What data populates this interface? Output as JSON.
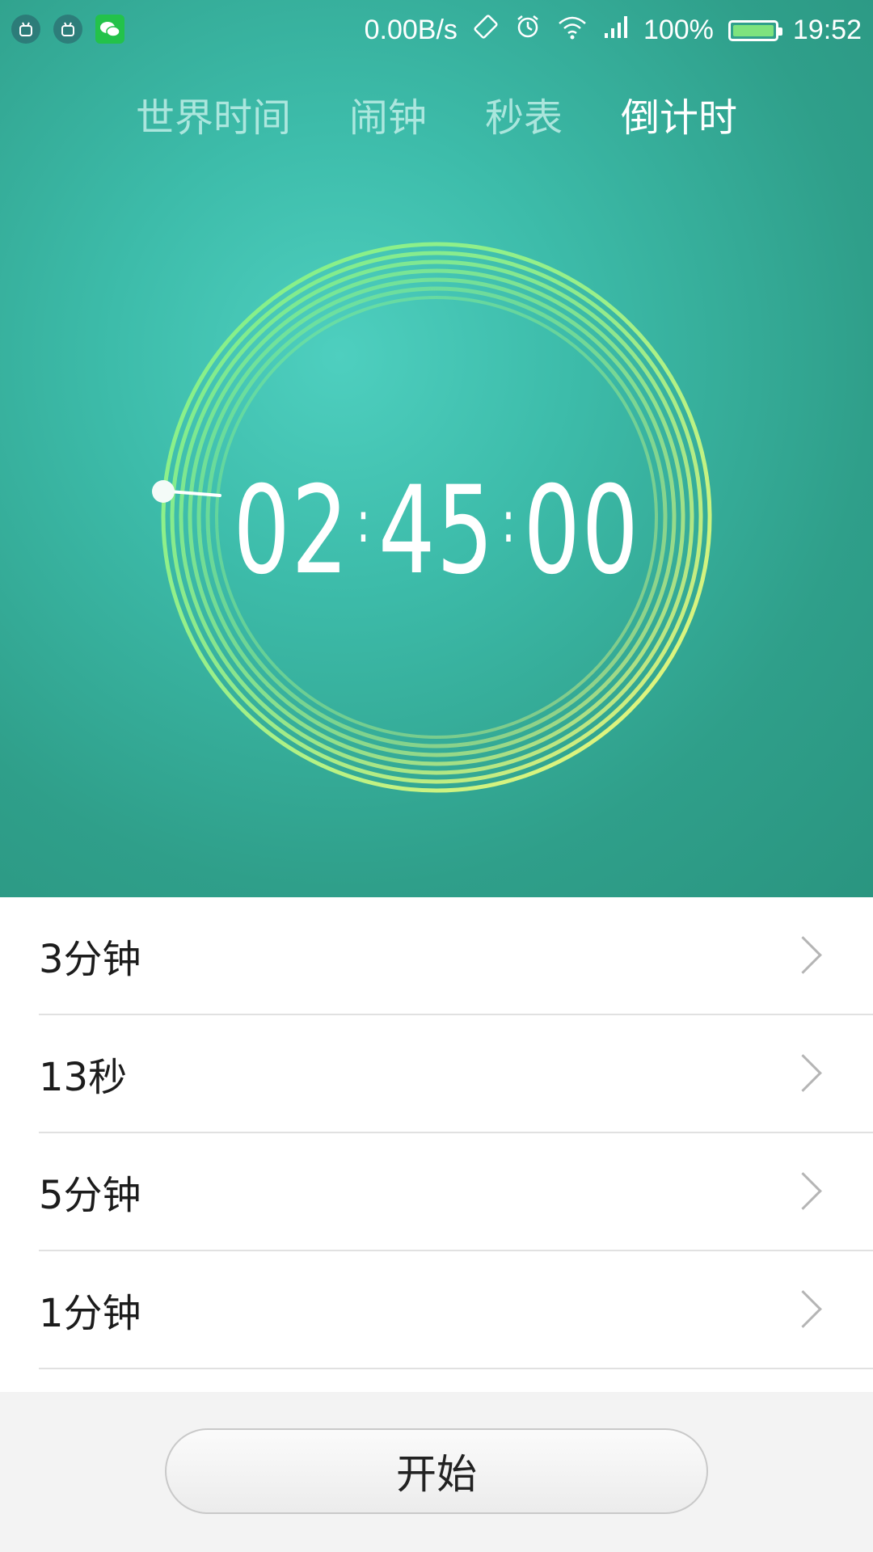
{
  "status_bar": {
    "net_speed": "0.00B/s",
    "battery_percent": "100%",
    "time": "19:52",
    "battery_level": 1.0,
    "left_icons": [
      "android-icon",
      "android-icon",
      "wechat-icon"
    ],
    "right_icons": [
      "rotation-lock-icon",
      "alarm-icon",
      "wifi-icon",
      "signal-icon",
      "battery-icon"
    ]
  },
  "tabs": [
    {
      "label": "世界时间",
      "active": false
    },
    {
      "label": "闹钟",
      "active": false
    },
    {
      "label": "秒表",
      "active": false
    },
    {
      "label": "倒计时",
      "active": true
    }
  ],
  "timer": {
    "hours": "02",
    "minutes": "45",
    "seconds": "00",
    "separator": ":"
  },
  "presets": [
    {
      "label": "3分钟"
    },
    {
      "label": "13秒"
    },
    {
      "label": "5分钟"
    },
    {
      "label": "1分钟"
    }
  ],
  "start_button": {
    "label": "开始"
  },
  "colors": {
    "accent_teal": "#3dbcaa",
    "ring_green": "#7ef08a",
    "ring_yellow": "#f4f57a"
  }
}
